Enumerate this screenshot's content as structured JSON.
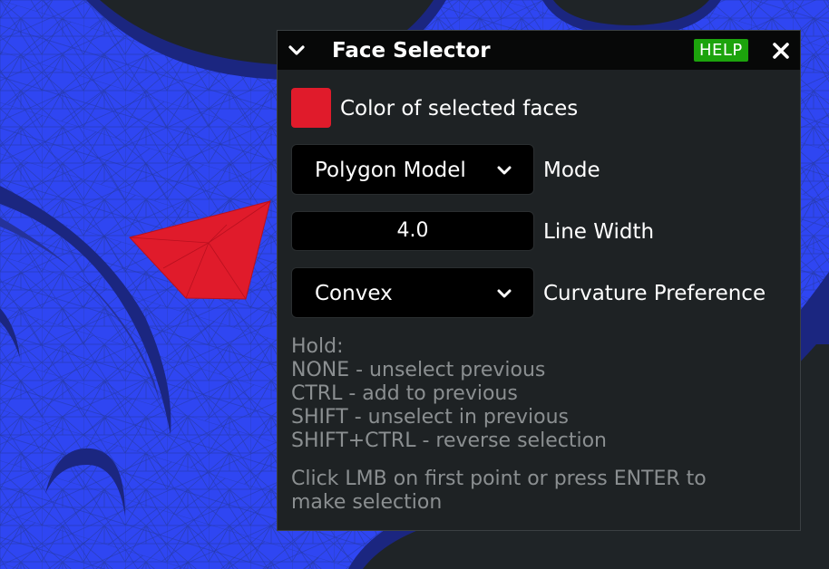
{
  "panel": {
    "title": "Face Selector",
    "help_label": "HELP",
    "color_label": "Color of selected faces",
    "selected_color": "#e01b2b",
    "mode": {
      "value": "Polygon Model",
      "label": "Mode"
    },
    "line_width": {
      "value": "4.0",
      "label": "Line Width"
    },
    "curvature": {
      "value": "Convex",
      "label": "Curvature Preference"
    },
    "hold_lines": [
      "Hold:",
      "NONE - unselect previous",
      "CTRL - add to previous",
      "SHIFT - unselect in previous",
      "SHIFT+CTRL - reverse selection"
    ],
    "instruction_lines": [
      "Click LMB on first point or press ENTER to",
      "make selection"
    ]
  },
  "colors": {
    "mesh": "#2f46f2",
    "mesh_dark": "#1b2680",
    "selection": "#e01b2b",
    "panel_bg": "#1e2224",
    "help_badge": "#1ca30c"
  },
  "icons": {
    "collapse": "chevron-down-icon",
    "close": "close-icon",
    "dropdown": "chevron-down-icon"
  }
}
